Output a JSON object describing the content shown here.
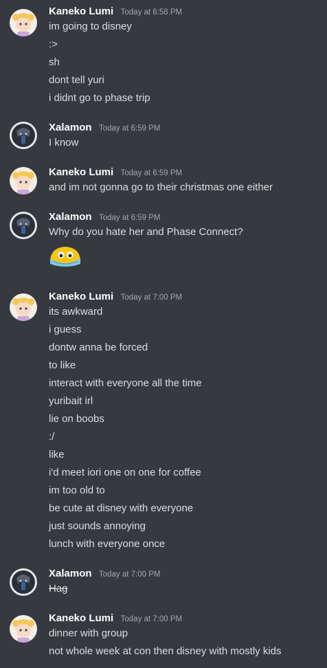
{
  "colors": {
    "background": "#36393f",
    "username": "#ffffff",
    "message_text": "#dcddde",
    "timestamp": "#a3a6aa"
  },
  "groups": [
    {
      "username": "Kaneko Lumi",
      "timestamp": "Today at 6:58 PM",
      "avatar_icon": "anime-girl-avatar-icon",
      "lines": [
        "im going to disney",
        ":>",
        "sh",
        "dont tell yuri",
        "i didnt go to phase trip"
      ]
    },
    {
      "username": "Xalamon",
      "timestamp": "Today at 6:59 PM",
      "avatar_icon": "dark-character-avatar-icon",
      "lines": [
        "I know"
      ]
    },
    {
      "username": "Kaneko Lumi",
      "timestamp": "Today at 6:59 PM",
      "avatar_icon": "anime-girl-avatar-icon",
      "lines": [
        "and im not gonna go to their christmas one either"
      ]
    },
    {
      "username": "Xalamon",
      "timestamp": "Today at 6:59 PM",
      "avatar_icon": "dark-character-avatar-icon",
      "lines": [
        "Why do you hate her and Phase Connect?"
      ],
      "emoji_icon": "crying-face-emoji-icon"
    },
    {
      "username": "Kaneko Lumi",
      "timestamp": "Today at 7:00 PM",
      "avatar_icon": "anime-girl-avatar-icon",
      "lines": [
        "its awkward",
        "i guess",
        "dontw anna be forced",
        "to like",
        "interact with everyone all the time",
        "yuribait irl",
        "lie on boobs",
        ":/",
        "like",
        "i'd meet iori one on one for coffee",
        "im too old to",
        "be cute at disney with everyone",
        "just sounds annoying",
        "lunch with everyone once"
      ]
    },
    {
      "username": "Xalamon",
      "timestamp": "Today at 7:00 PM",
      "avatar_icon": "dark-character-avatar-icon",
      "lines": [
        "Hag"
      ],
      "strikethrough": true
    },
    {
      "username": "Kaneko Lumi",
      "timestamp": "Today at 7:00 PM",
      "avatar_icon": "anime-girl-avatar-icon",
      "lines": [
        "dinner with group",
        "not whole week at con then disney with mostly kids"
      ]
    }
  ]
}
